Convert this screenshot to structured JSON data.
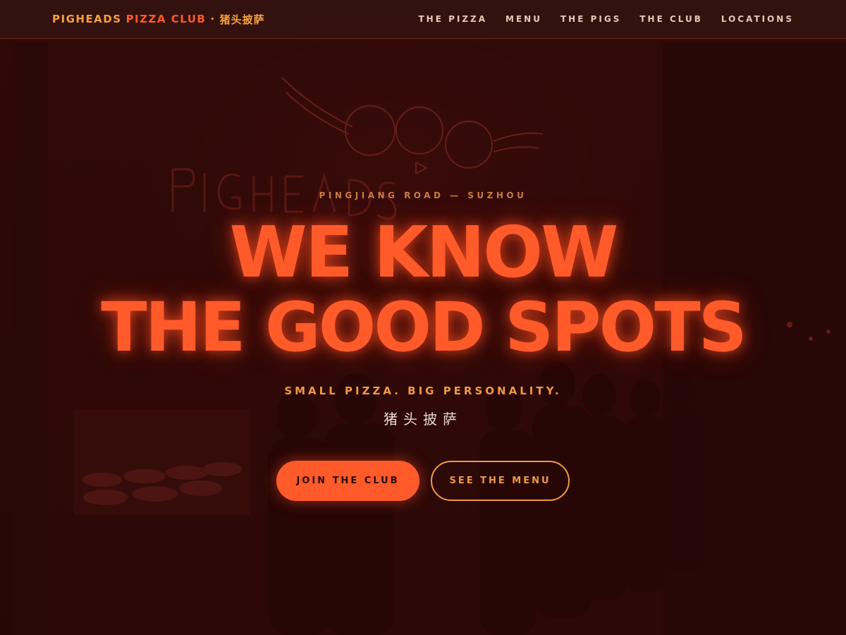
{
  "brand": {
    "part1": "PIGHEADS",
    "part2": "PIZZA CLUB",
    "separator": "·",
    "chinese": "猪头披萨"
  },
  "nav": {
    "items": [
      {
        "label": "THE PIZZA"
      },
      {
        "label": "MENU"
      },
      {
        "label": "THE PIGS"
      },
      {
        "label": "THE CLUB"
      },
      {
        "label": "LOCATIONS"
      }
    ]
  },
  "hero": {
    "eyebrow": "PINGJIANG ROAD — SUZHOU",
    "headline_line1": "WE KNOW",
    "headline_line2": "THE GOOD SPOTS",
    "tagline": "SMALL PIZZA. BIG PERSONALITY.",
    "tagline_chinese": "猪头披萨",
    "primary_cta": "JOIN THE CLUB",
    "secondary_cta": "SEE THE MENU",
    "background_sign_text": "PIGHEADS PIZZA CLUB"
  },
  "colors": {
    "accent": "#ff5a2a",
    "gold": "#f09a44",
    "background": "#260908",
    "nav_bg": "#341210"
  }
}
